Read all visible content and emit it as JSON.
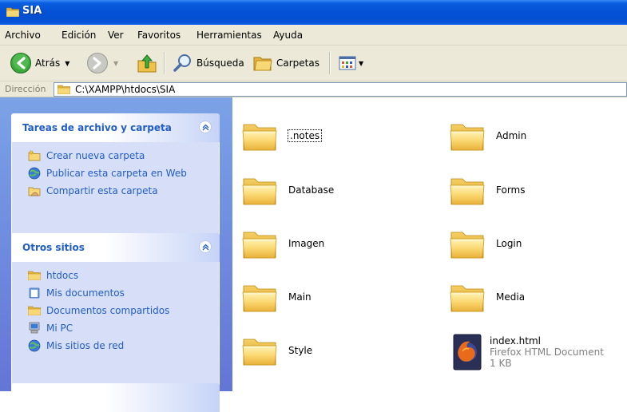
{
  "window": {
    "title": "SIA"
  },
  "menu": [
    "Archivo",
    "Edición",
    "Ver",
    "Favoritos",
    "Herramientas",
    "Ayuda"
  ],
  "toolbar": {
    "back_label": "Atrás",
    "search_label": "Búsqueda",
    "folders_label": "Carpetas"
  },
  "address": {
    "label": "Dirección",
    "path": "C:\\XAMPP\\htdocs\\SIA"
  },
  "tasks_panel": {
    "title": "Tareas de archivo y carpeta",
    "items": [
      "Crear nueva carpeta",
      "Publicar esta carpeta en Web",
      "Compartir esta carpeta"
    ]
  },
  "other_panel": {
    "title": "Otros sitios",
    "items": [
      "htdocs",
      "Mis documentos",
      "Documentos compartidos",
      "Mi PC",
      "Mis sitios de red"
    ]
  },
  "items": [
    {
      "name": ".notes",
      "type": "folder"
    },
    {
      "name": "Admin",
      "type": "folder"
    },
    {
      "name": "Database",
      "type": "folder"
    },
    {
      "name": "Forms",
      "type": "folder"
    },
    {
      "name": "Imagen",
      "type": "folder"
    },
    {
      "name": "Login",
      "type": "folder"
    },
    {
      "name": "Main",
      "type": "folder"
    },
    {
      "name": "Media",
      "type": "folder"
    },
    {
      "name": "Style",
      "type": "folder"
    },
    {
      "name": "index.html",
      "type": "file",
      "kind": "Firefox HTML Document",
      "size": "1 KB"
    }
  ]
}
